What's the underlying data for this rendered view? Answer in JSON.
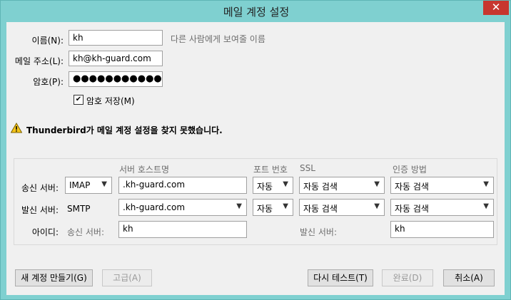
{
  "window": {
    "title": "메일 계정 설정",
    "close_label": "✕"
  },
  "form": {
    "name_label": "이름(N):",
    "name_value": "kh",
    "name_hint": "다른 사람에게 보여줄 이름",
    "email_label": "메일 주소(L):",
    "email_value": "kh@kh-guard.com",
    "password_label": "암호(P):",
    "password_value": "●●●●●●●●●●●",
    "remember_label": "암호 저장(M)",
    "remember_checked": "✔"
  },
  "warning": {
    "text": "Thunderbird가 메일 계정 설정을 찾지 못했습니다."
  },
  "server_table": {
    "headers": {
      "hostname": "서버 호스트명",
      "port": "포트 번호",
      "ssl": "SSL",
      "auth": "인증 방법"
    },
    "incoming": {
      "label": "송신 서버:",
      "protocol": "IMAP",
      "hostname": ".kh-guard.com",
      "port": "자동",
      "ssl": "자동 검색",
      "auth": "자동 검색"
    },
    "outgoing": {
      "label": "발신 서버:",
      "protocol": "SMTP",
      "hostname": ".kh-guard.com",
      "port": "자동",
      "ssl": "자동 검색",
      "auth": "자동 검색"
    },
    "username": {
      "label": "아이디:",
      "incoming_label": "송신 서버:",
      "incoming_value": "kh",
      "outgoing_label": "발신 서버:",
      "outgoing_value": "kh"
    }
  },
  "buttons": {
    "new_account": "새 계정 만들기(G)",
    "advanced": "고급(A)",
    "retest": "다시 테스트(T)",
    "done": "완료(D)",
    "cancel": "취소(A)"
  }
}
